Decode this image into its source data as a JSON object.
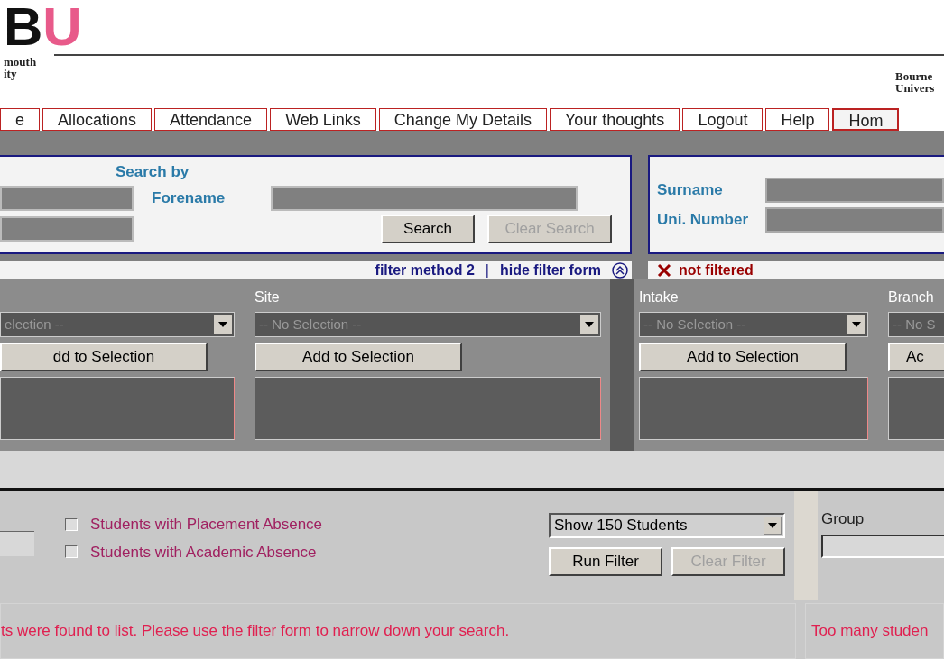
{
  "header": {
    "logo_letters": [
      "B",
      "U"
    ],
    "left_lines": [
      "mouth",
      "ity"
    ],
    "right_lines": [
      "Bourne",
      "Univers"
    ]
  },
  "nav": [
    {
      "label": "e",
      "selected": false
    },
    {
      "label": "Allocations",
      "selected": false
    },
    {
      "label": "Attendance",
      "selected": false
    },
    {
      "label": "Web Links",
      "selected": false
    },
    {
      "label": "Change My Details",
      "selected": false
    },
    {
      "label": "Your thoughts",
      "selected": false
    },
    {
      "label": "Logout",
      "selected": false
    },
    {
      "label": "Help",
      "selected": false
    },
    {
      "label": "Hom",
      "selected": true
    }
  ],
  "search": {
    "heading": "Search by",
    "forename_label": "Forename",
    "surname_label": "Surname",
    "number_label": "Uni. Number",
    "buttons": [
      {
        "label": "Search",
        "disabled": false
      },
      {
        "label": "Clear Search",
        "disabled": true
      }
    ]
  },
  "filter_links": {
    "method": "filter method 2",
    "separator": "|",
    "hide": "hide filter form",
    "status": "not filtered"
  },
  "filter_columns": [
    {
      "select": "election --",
      "button": "dd to Selection"
    },
    {
      "label": "Site",
      "select": "-- No Selection --",
      "button": "Add to Selection"
    },
    {
      "label": "Intake",
      "select": "-- No Selection --",
      "button": "Add to Selection"
    },
    {
      "label": "Branch",
      "select": "-- No S",
      "button": "Ac"
    }
  ],
  "options": [
    {
      "label": "Students with Placement Absence",
      "checked": false
    },
    {
      "label": "Students with Academic Absence",
      "checked": false
    }
  ],
  "show_select": "Show 150 Students",
  "filter_buttons": [
    {
      "label": "Run Filter",
      "disabled": false
    },
    {
      "label": "Clear Filter",
      "disabled": true
    }
  ],
  "group_label": "Group",
  "messages": [
    "ts were found to list. Please use the filter form to narrow down your search.",
    "Too many studen"
  ]
}
